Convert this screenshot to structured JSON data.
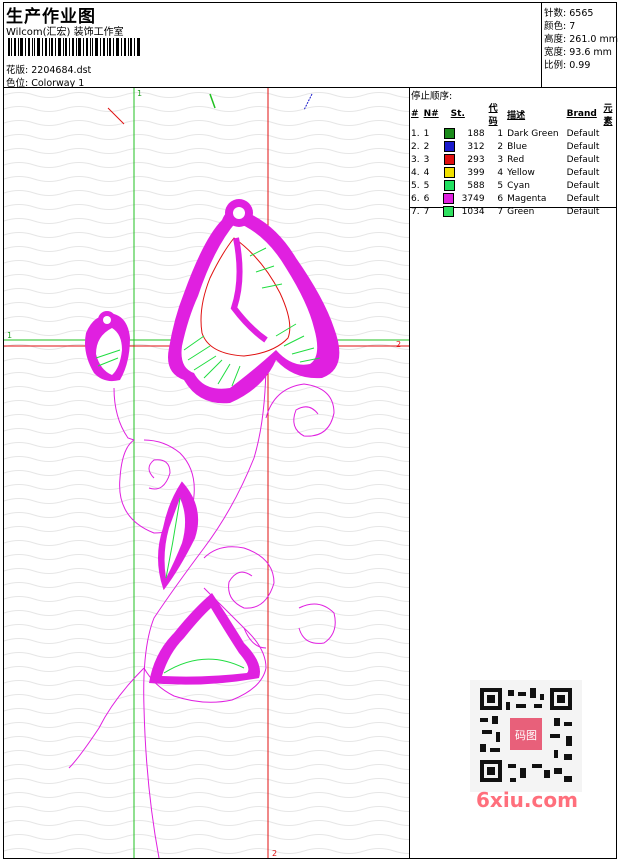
{
  "header": {
    "title": "生产作业图",
    "company": "Wilcom(汇宏) 装饰工作室",
    "pattern_label": "花版:",
    "pattern_value": "2204684.dst",
    "colorway_label": "色位:",
    "colorway_value": "Colorway 1"
  },
  "stats": [
    {
      "label": "针数:",
      "value": "6565"
    },
    {
      "label": "颜色:",
      "value": "7"
    },
    {
      "label": "高度:",
      "value": "261.0 mm"
    },
    {
      "label": "宽度:",
      "value": "93.6 mm"
    },
    {
      "label": "比例:",
      "value": "0.99"
    }
  ],
  "stop_sequence": {
    "title": "停止顺序:",
    "columns": [
      "#",
      "N#",
      "St.",
      "代码",
      "描述",
      "Brand",
      "元素"
    ],
    "rows": [
      {
        "n": "1.",
        "code": "1",
        "color": "#1a8a1a",
        "st": "188",
        "idx": "1",
        "desc": "Dark Green",
        "brand": "Default"
      },
      {
        "n": "2.",
        "code": "2",
        "color": "#1a1acc",
        "st": "312",
        "idx": "2",
        "desc": "Blue",
        "brand": "Default"
      },
      {
        "n": "3.",
        "code": "3",
        "color": "#e01010",
        "st": "293",
        "idx": "3",
        "desc": "Red",
        "brand": "Default"
      },
      {
        "n": "4.",
        "code": "4",
        "color": "#f0e000",
        "st": "399",
        "idx": "4",
        "desc": "Yellow",
        "brand": "Default"
      },
      {
        "n": "5.",
        "code": "5",
        "color": "#20e060",
        "st": "588",
        "idx": "5",
        "desc": "Cyan",
        "brand": "Default"
      },
      {
        "n": "6.",
        "code": "6",
        "color": "#e020e0",
        "st": "3749",
        "idx": "6",
        "desc": "Magenta",
        "brand": "Default"
      },
      {
        "n": "7.",
        "code": "7",
        "color": "#30e060",
        "st": "1034",
        "idx": "7",
        "desc": "Green",
        "brand": "Default"
      }
    ]
  },
  "guides": {
    "v1": "1",
    "v2": "2",
    "h1": "1",
    "h2": "2"
  },
  "watermark": {
    "qr_text": "码图",
    "brand": "6xiu.com"
  },
  "colors": {
    "magenta": "#e020e0",
    "green": "#20dd40",
    "red": "#e01010",
    "blue": "#1a1acc"
  }
}
